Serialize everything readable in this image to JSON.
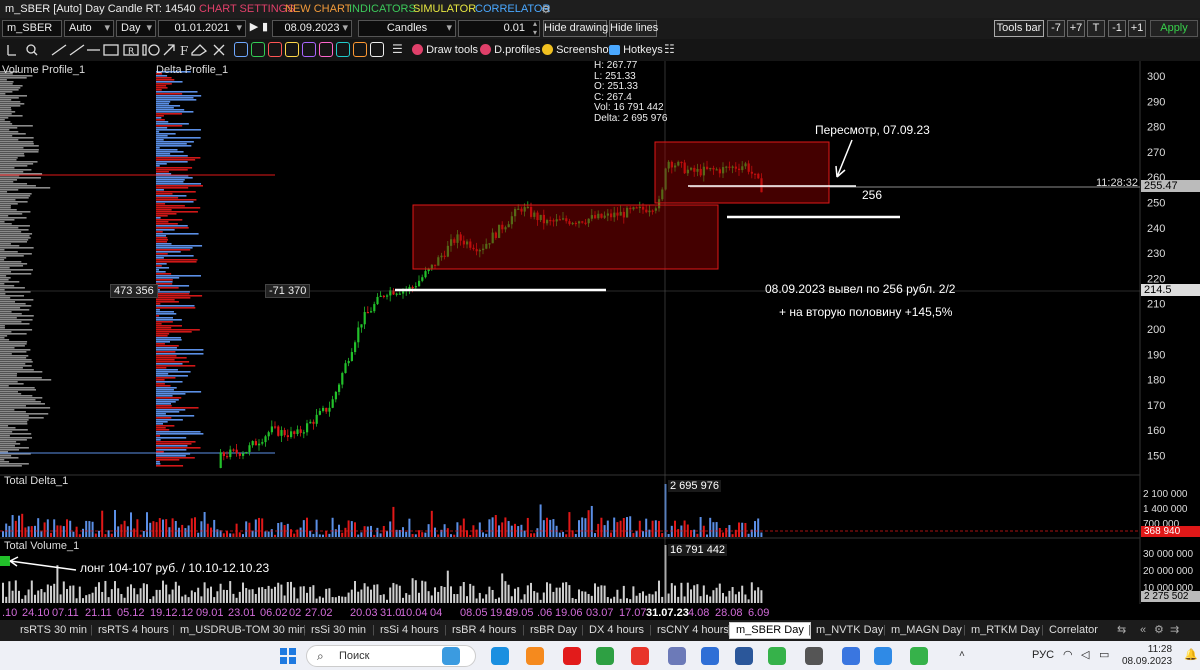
{
  "titlebar": {
    "title": "m_SBER [Auto] Day Candle RT: 14540",
    "menu": [
      "CHART SETTINGS",
      "NEW CHART",
      "INDICATORS",
      "SIMULATOR",
      "CORRELATOR"
    ],
    "menu_colors": [
      "#e0406a",
      "#f29a3a",
      "#3cc85a",
      "#e6e640",
      "#4aa8ff"
    ]
  },
  "toolbar": {
    "symbol": "m_SBER",
    "mode": "Auto",
    "timeframe": "Day",
    "date_from": "01.01.2021",
    "date_to": "08.09.2023",
    "chart_type": "Candles",
    "step": "0.01",
    "hide_drawing": "Hide drawing",
    "hide_lines": "Hide lines",
    "tools_bar": "Tools bar",
    "minus7": "-7",
    "plus7": "+7",
    "t": "T",
    "minus1": "-1",
    "plus1": "+1",
    "apply": "Apply"
  },
  "toolbar2": {
    "draw_tools": "Draw tools",
    "profiles": "D.profiles",
    "screenshot": "Screenshot",
    "hotkeys": "Hotkeys",
    "tool_icons": [
      "ruler-icon",
      "zoom-icon",
      "line-icon",
      "ray-icon",
      "hline-icon",
      "rect-icon",
      "text-tool-icon",
      "label-icon",
      "circle-icon",
      "arrow-icon",
      "fibo-icon",
      "eraser-icon"
    ],
    "color_swatches": [
      "#6fa8ff",
      "#33cc55",
      "#ff5555",
      "#ffd84a",
      "#aa66ff",
      "#ff66cc",
      "#22cccc",
      "#ff9933",
      "#eeeeee"
    ]
  },
  "chart": {
    "labels": {
      "volume_profile": "Volume Profile_1",
      "delta_profile": "Delta Profile_1",
      "total_delta": "Total Delta_1",
      "total_volume": "Total Volume_1"
    },
    "ohlc": {
      "h": "H: 267.77",
      "l": "L: 251.33",
      "o": "O: 251.33",
      "c": "C: 267.4",
      "vol": "Vol: 16 791 442",
      "delta": "Delta: 2 695 976"
    },
    "cross_labels": {
      "volume": "473 356",
      "delta": "-71 370",
      "price": "214.5",
      "current_price": "255.47",
      "time": "11:28:32"
    },
    "annotations": {
      "review": "Пересмотр, 07.09.23",
      "level": "256",
      "exit": "08.09.2023 вывел по 256 рубл. 2/2",
      "profit": "+ на вторую половину +145,5%",
      "long": "лонг 104-107 руб. / 10.10-12.10.23"
    },
    "delta_peak": "2 695 976",
    "volume_peak": "16 791 442",
    "price_axis": [
      "300",
      "290",
      "280",
      "270",
      "260",
      "250",
      "240",
      "230",
      "220",
      "210",
      "200",
      "190",
      "180",
      "170",
      "160",
      "150"
    ],
    "delta_axis": [
      "2 100 000",
      "1 400 000",
      "700 000"
    ],
    "delta_current": "368 940",
    "volume_axis": [
      "30 000 000",
      "20 000 000",
      "10 000 000"
    ],
    "volume_current": "2 275 502",
    "date_axis": [
      ".10",
      "24.10",
      "07.11",
      "21.11",
      "05.12",
      "19.12",
      ".12",
      "09.01",
      "23.01",
      "06.02",
      "02",
      "27.02",
      "20.03",
      "31.0",
      "10.04",
      "04",
      "08.05",
      "19.0",
      "29.05",
      ".06",
      "19.06",
      "03.07",
      "17.07",
      "31.07.23",
      "4.08",
      "28.08",
      "6.09"
    ],
    "colors": {
      "up": "#22c02a",
      "down": "#e01818",
      "delta_pos": "#5b8fe6",
      "delta_neg": "#e01818",
      "volume": "#cfcfcf",
      "zone": "#c00000"
    }
  },
  "tabs": [
    "rsRTS 30 min",
    "rsRTS 4 hours",
    "m_USDRUB-TOM 30 min",
    "rsSi 30 min",
    "rsSi 4 hours",
    "rsBR 4 hours",
    "rsBR Day",
    "DX 4 hours",
    "rsCNY 4 hours",
    "m_SBER Day",
    "m_NVTK Day",
    "m_MAGN Day",
    "m_RTKM Day",
    "Correlator"
  ],
  "active_tab": "m_SBER Day",
  "taskbar": {
    "search": "Поиск",
    "lang": "РУС",
    "time": "11:28",
    "date": "08.09.2023"
  }
}
